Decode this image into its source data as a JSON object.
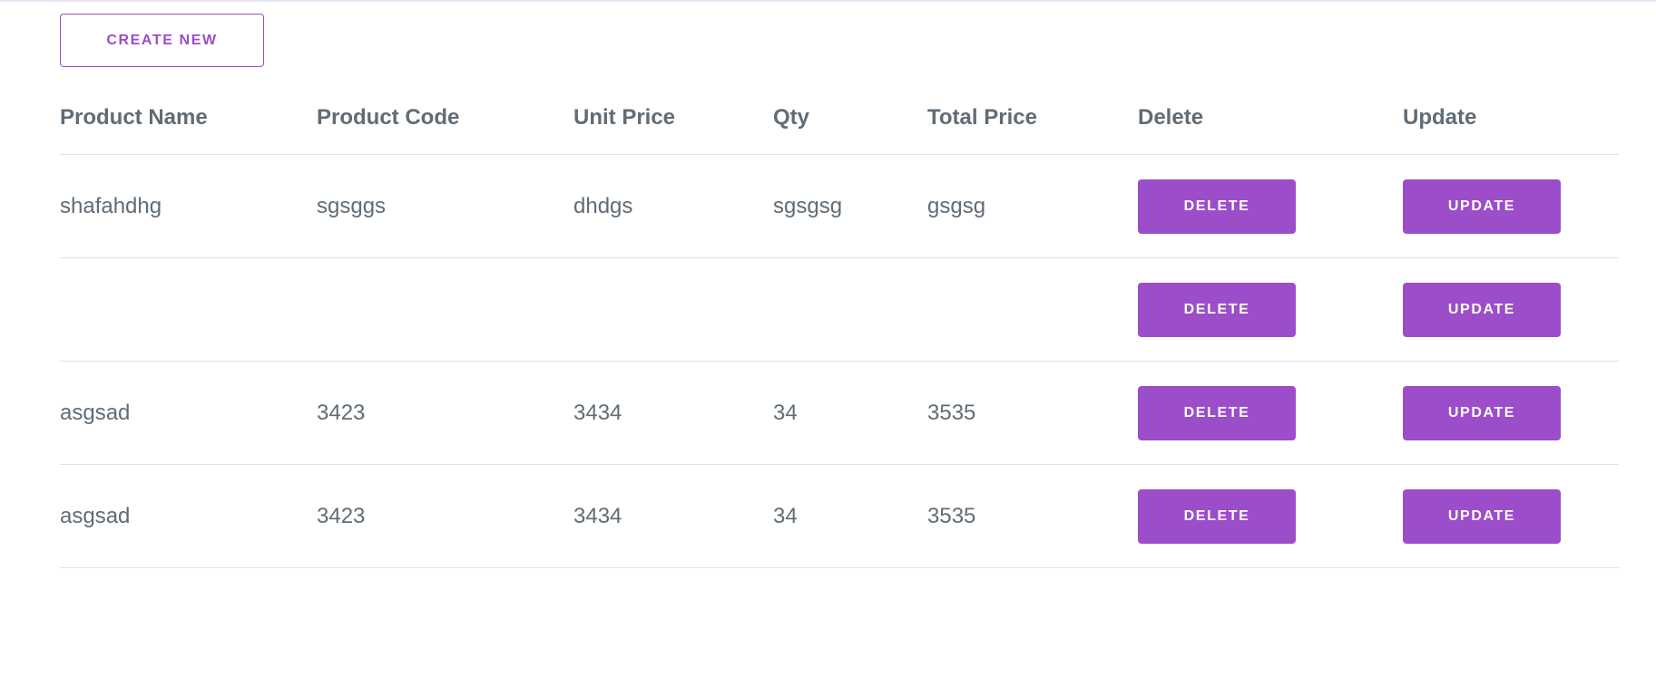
{
  "toolbar": {
    "create_label": "CREATE NEW"
  },
  "table": {
    "headers": [
      "Product Name",
      "Product Code",
      "Unit Price",
      "Qty",
      "Total Price",
      "Delete",
      "Update"
    ],
    "delete_label": "DELETE",
    "update_label": "UPDATE",
    "rows": [
      {
        "name": "shafahdhg",
        "code": "sgsggs",
        "unit_price": "dhdgs",
        "qty": "sgsgsg",
        "total_price": "gsgsg"
      },
      {
        "name": "",
        "code": "",
        "unit_price": "",
        "qty": "",
        "total_price": ""
      },
      {
        "name": "asgsad",
        "code": "3423",
        "unit_price": "3434",
        "qty": "34",
        "total_price": "3535"
      },
      {
        "name": "asgsad",
        "code": "3423",
        "unit_price": "3434",
        "qty": "34",
        "total_price": "3535"
      }
    ]
  },
  "colors": {
    "accent": "#9b4dca",
    "text": "#606c76",
    "divider": "#e1e1e1"
  }
}
